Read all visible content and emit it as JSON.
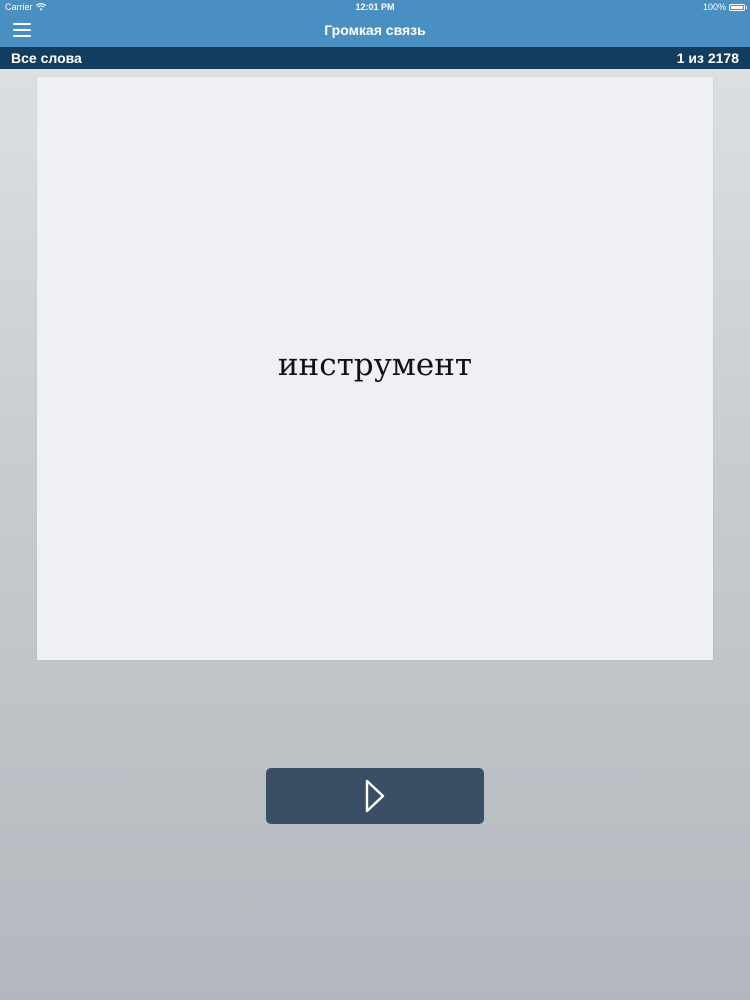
{
  "status_bar": {
    "carrier": "Carrier",
    "time": "12:01 PM",
    "battery": "100%"
  },
  "nav": {
    "title": "Громкая связь",
    "menu_icon": "hamburger-menu-icon"
  },
  "sub_header": {
    "list_name": "Все слова",
    "counter": "1 из 2178"
  },
  "card": {
    "word": "инструмент"
  },
  "controls": {
    "play_icon": "play-icon"
  },
  "colors": {
    "nav_bar": "#4a8fc1",
    "sub_bar": "#123d5e",
    "card": "#eef0f3",
    "play_button": "#3a4e66"
  }
}
